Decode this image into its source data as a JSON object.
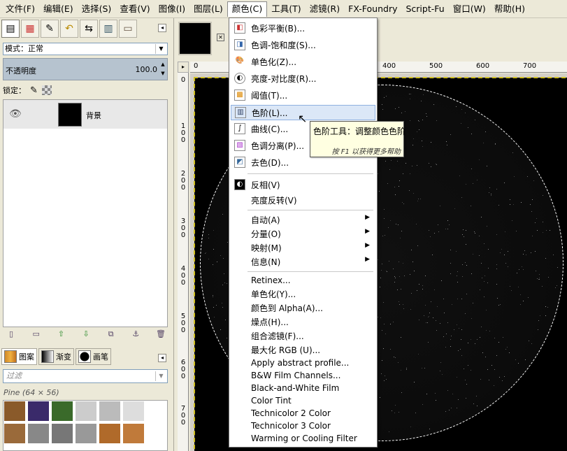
{
  "menubar": [
    {
      "label": "文件(F)"
    },
    {
      "label": "编辑(E)"
    },
    {
      "label": "选择(S)"
    },
    {
      "label": "查看(V)"
    },
    {
      "label": "图像(I)"
    },
    {
      "label": "图层(L)"
    },
    {
      "label": "颜色(C)"
    },
    {
      "label": "工具(T)"
    },
    {
      "label": "滤镜(R)"
    },
    {
      "label": "FX-Foundry"
    },
    {
      "label": "Script-Fu"
    },
    {
      "label": "窗口(W)"
    },
    {
      "label": "帮助(H)"
    }
  ],
  "dock": {
    "mode_label": "模式：",
    "mode_value": "正常",
    "opacity_label": "不透明度",
    "opacity_value": "100.0",
    "lock_label": "锁定：",
    "layer_name": "背景",
    "pattern_tabs": [
      {
        "label": "图案"
      },
      {
        "label": "渐变"
      },
      {
        "label": "画笔"
      }
    ],
    "filter_placeholder": "过滤",
    "pattern_name": "Pine (64 × 56)"
  },
  "image_window": {
    "ruler_h_labels": [
      "0",
      "400",
      "500",
      "600",
      "700"
    ],
    "ruler_v_labels": [
      "0",
      "100",
      "200",
      "300",
      "400",
      "500",
      "600",
      "700"
    ]
  },
  "colors_menu": {
    "items": [
      {
        "label": "色彩平衡(B)...",
        "icon": "color-balance-icon"
      },
      {
        "label": "色调-饱和度(S)...",
        "icon": "hue-saturation-icon"
      },
      {
        "label": "单色化(Z)...",
        "icon": "colorize-icon"
      },
      {
        "label": "亮度-对比度(R)...",
        "icon": "brightness-contrast-icon"
      },
      {
        "label": "阈值(T)...",
        "icon": "threshold-icon"
      },
      {
        "label": "色阶(L)...",
        "icon": "levels-icon"
      },
      {
        "label": "曲线(C)...",
        "icon": "curves-icon"
      },
      {
        "label": "色调分离(P)...",
        "icon": "posterize-icon"
      },
      {
        "label": "去色(D)...",
        "icon": "desaturate-icon"
      },
      {
        "label": "反相(V)",
        "icon": "invert-icon"
      },
      {
        "label": "亮度反转(V)",
        "icon": ""
      },
      {
        "label": "自动(A)",
        "icon": "",
        "submenu": true
      },
      {
        "label": "分量(O)",
        "icon": "",
        "submenu": true
      },
      {
        "label": "映射(M)",
        "icon": "",
        "submenu": true
      },
      {
        "label": "信息(N)",
        "icon": "",
        "submenu": true
      },
      {
        "label": "Retinex..."
      },
      {
        "label": "单色化(Y)..."
      },
      {
        "label": "颜色到 Alpha(A)..."
      },
      {
        "label": "燥点(H)..."
      },
      {
        "label": "组合滤镜(F)..."
      },
      {
        "label": "最大化 RGB (U)..."
      },
      {
        "label": "Apply abstract profile..."
      },
      {
        "label": "B&W Film Channels..."
      },
      {
        "label": "Black-and-White Film"
      },
      {
        "label": "Color Tint"
      },
      {
        "label": "Technicolor 2 Color"
      },
      {
        "label": "Technicolor 3 Color"
      },
      {
        "label": "Warming or Cooling Filter"
      }
    ],
    "hovered_index": 5
  },
  "tooltip": {
    "title": "色阶工具：调整颜色色阶",
    "help": "按 F1 以获得更多帮助"
  }
}
